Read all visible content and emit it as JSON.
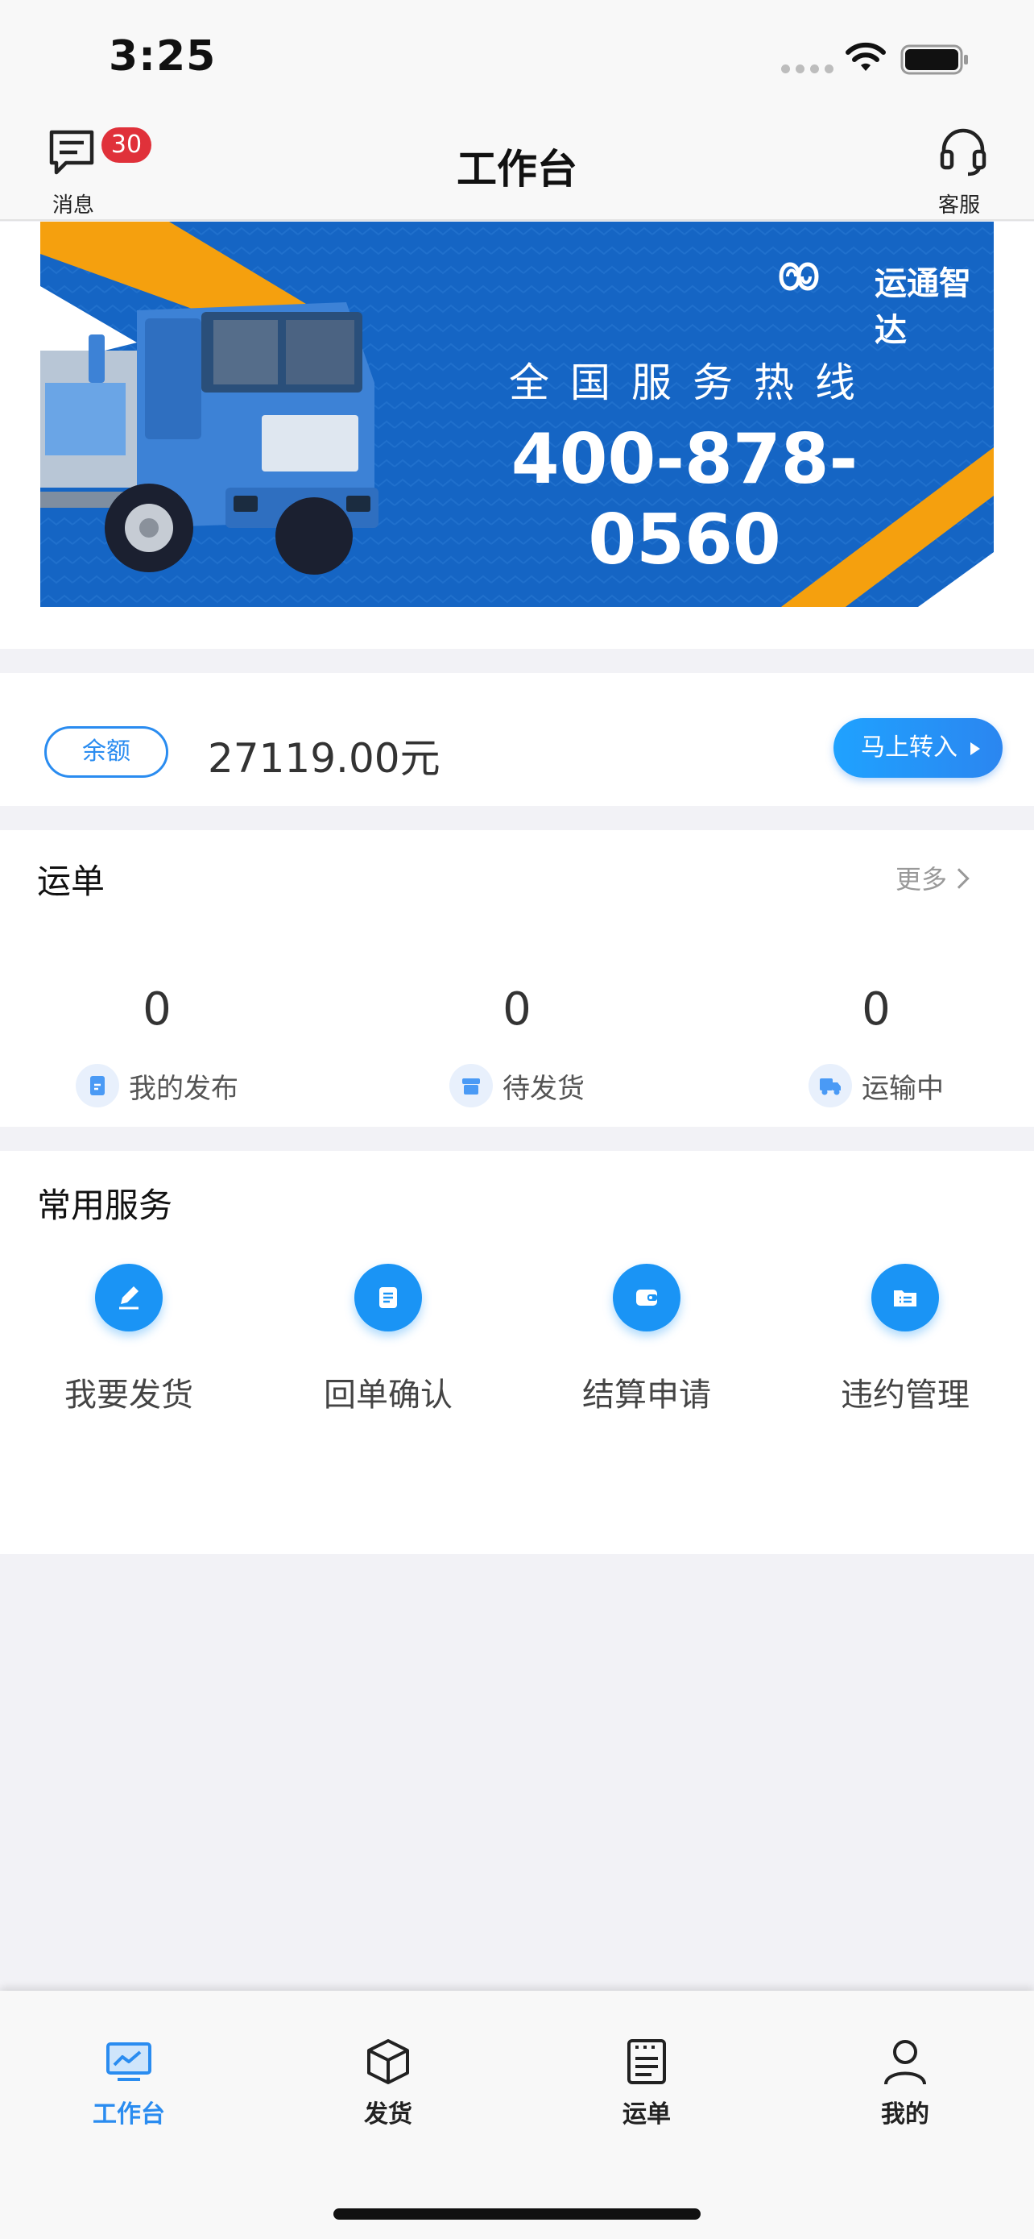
{
  "status_bar": {
    "time": "3:25"
  },
  "nav": {
    "title": "工作台",
    "messages_label": "消息",
    "messages_badge": "30",
    "service_label": "客服"
  },
  "banner": {
    "brand": "运通智达",
    "hotline_label": "全国服务热线",
    "phone": "400-878-0560"
  },
  "balance": {
    "label": "余额",
    "amount": "27119.00元",
    "transfer_label": "马上转入"
  },
  "waybill": {
    "title": "运单",
    "more_label": "更多",
    "stats": [
      {
        "value": "0",
        "label": "我的发布"
      },
      {
        "value": "0",
        "label": "待发货"
      },
      {
        "value": "0",
        "label": "运输中"
      }
    ]
  },
  "services": {
    "title": "常用服务",
    "items": [
      {
        "label": "我要发货",
        "icon": "edit-icon"
      },
      {
        "label": "回单确认",
        "icon": "receipt-icon"
      },
      {
        "label": "结算申请",
        "icon": "wallet-icon"
      },
      {
        "label": "违约管理",
        "icon": "folder-list-icon"
      }
    ]
  },
  "tabs": [
    {
      "label": "工作台",
      "icon": "monitor-chart-icon",
      "active": true
    },
    {
      "label": "发货",
      "icon": "box-icon",
      "active": false
    },
    {
      "label": "运单",
      "icon": "document-list-icon",
      "active": false
    },
    {
      "label": "我的",
      "icon": "person-icon",
      "active": false
    }
  ],
  "colors": {
    "accent": "#2a8cf0",
    "badge": "#e0313a",
    "banner_blue": "#1668c4",
    "banner_orange": "#f5a00e"
  }
}
